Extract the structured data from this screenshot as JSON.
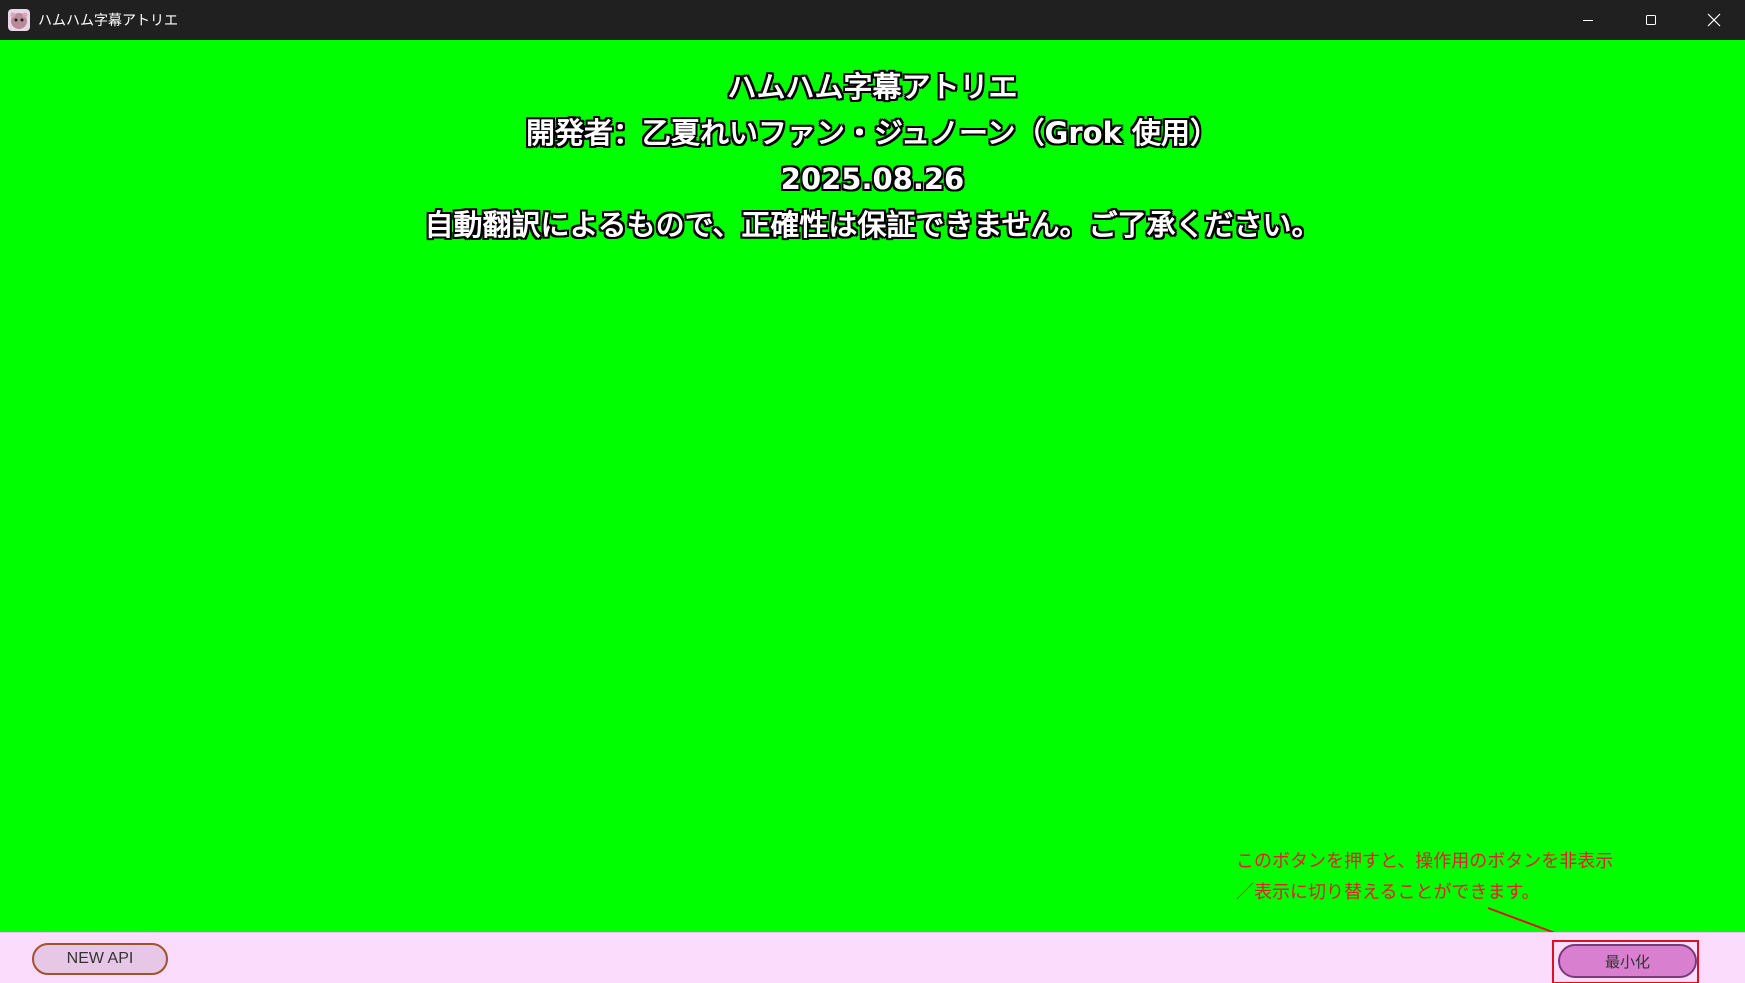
{
  "window": {
    "title": "ハムハム字幕アトリエ",
    "background_color": "#00ff00"
  },
  "credits": {
    "line1": "ハムハム字幕アトリエ",
    "line2": "開発者：乙夏れいファン・ジュノーン（Grok 使用）",
    "line3": "2025.08.26",
    "line4": "自動翻訳によるもので、正確性は保証できません。ご了承ください。"
  },
  "annotation": {
    "line1": "このボタンを押すと、操作用のボタンを非表示",
    "line2": "／表示に切り替えることができます。",
    "color": "#e0202a"
  },
  "bottombar": {
    "new_api_label": "NEW API",
    "minimize_label": "最小化",
    "background_color": "#fcdcfc"
  },
  "icons": {
    "app": "hamster-app-icon",
    "minimize": "window-minimize-icon",
    "maximize": "window-maximize-icon",
    "close": "window-close-icon"
  }
}
